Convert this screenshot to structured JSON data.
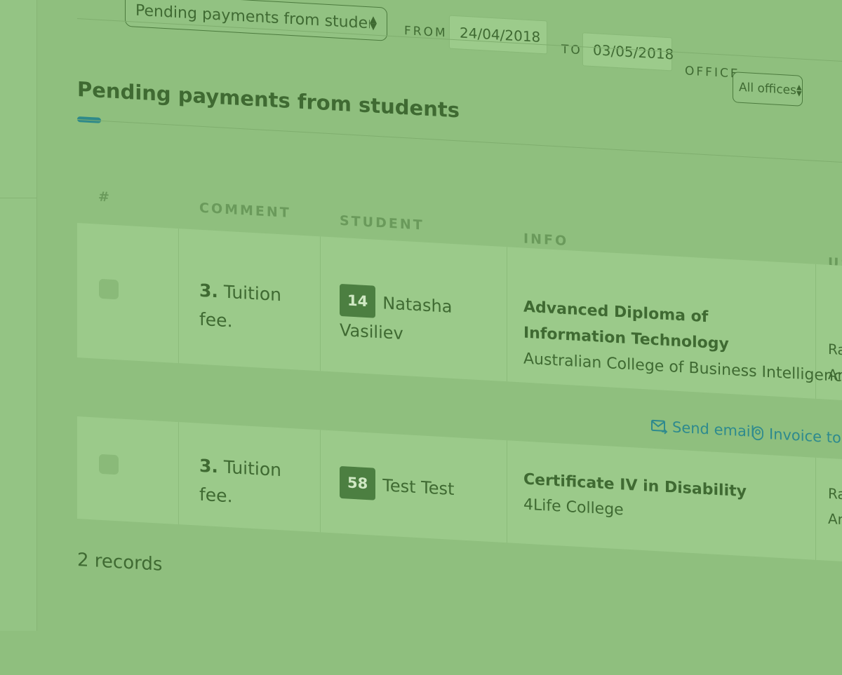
{
  "filter": {
    "report_select": "Pending payments from students",
    "from_label": "FROM",
    "from_date": "24/04/2018",
    "to_label": "TO",
    "to_date": "03/05/2018",
    "office_label": "OFFICE",
    "office_value": "All offices"
  },
  "page_title": "Pending payments from students",
  "table": {
    "headers": {
      "num": "#",
      "comment": "COMMENT",
      "student": "STUDENT",
      "info": "INFO",
      "user": "US"
    },
    "rows": [
      {
        "comment_num": "3.",
        "comment_text": "Tuition fee.",
        "student_id": "14",
        "student_name": "Natasha Vasiliev",
        "course": "Advanced Diploma of Information Technology",
        "college": "Australian College of Business Intelligence",
        "user_line1": "Ra",
        "user_line2": "Ari"
      },
      {
        "comment_num": "3.",
        "comment_text": "Tuition fee.",
        "student_id": "58",
        "student_name": "Test Test",
        "course": "Certificate IV in Disability",
        "college": "4Life College",
        "user_line1": "Ra",
        "user_line2": "Ari"
      }
    ],
    "actions": {
      "send_email": "Send email",
      "invoice": "Invoice to stu"
    }
  },
  "records_count": "2 records",
  "colors": {
    "background": "#8fbf7e",
    "accent": "#2f8a8a",
    "badge": "#4c7f41"
  }
}
